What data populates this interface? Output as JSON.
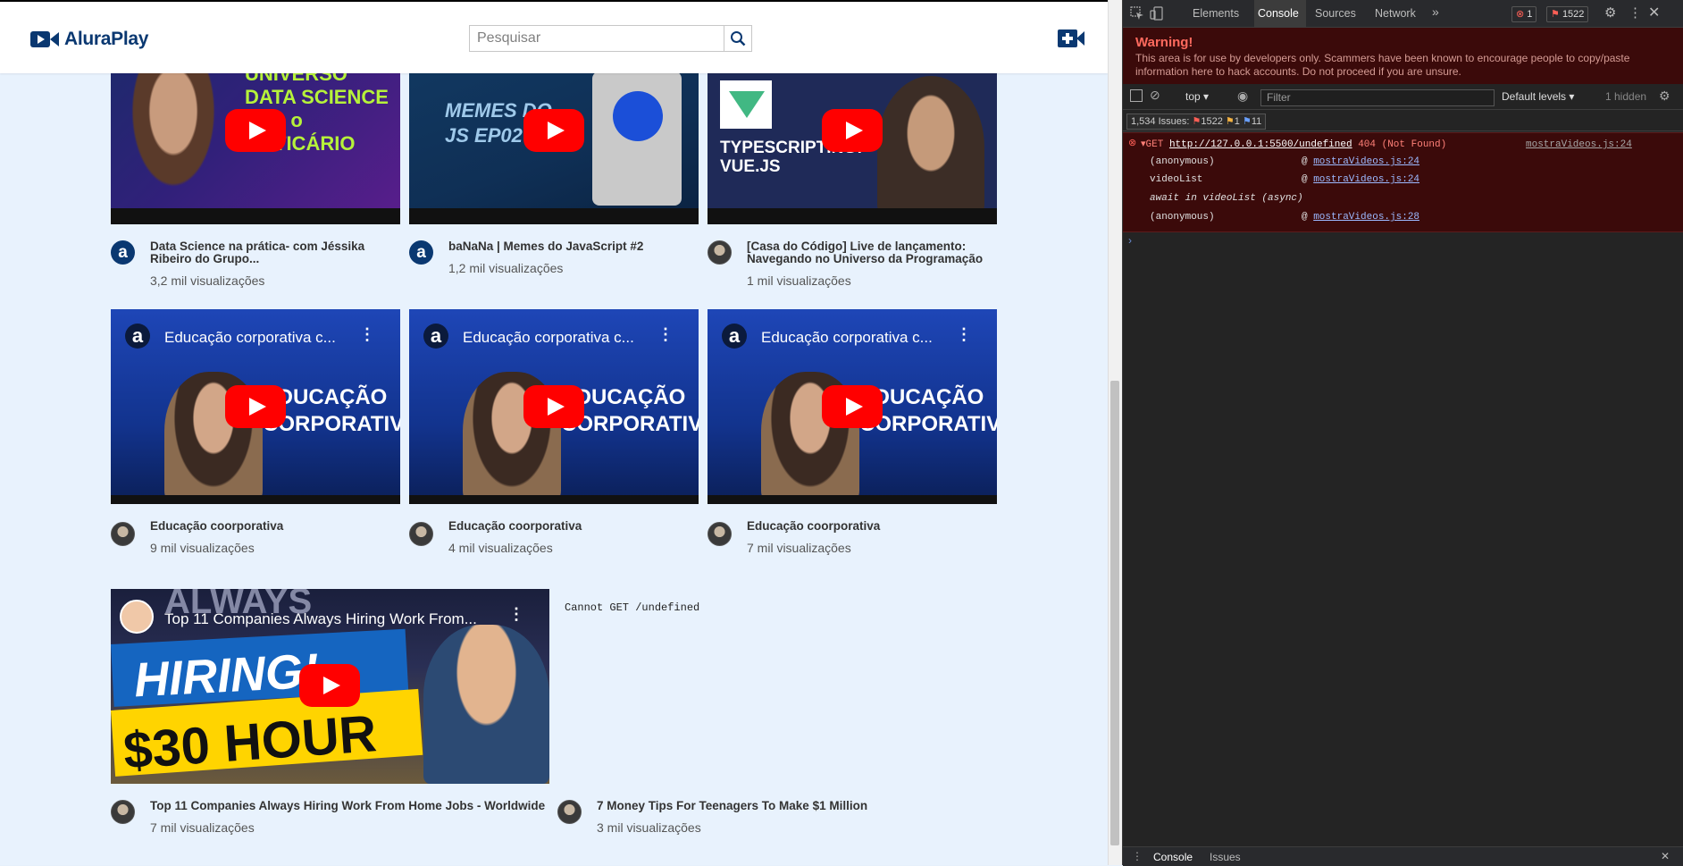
{
  "app": {
    "logo_text": "AluraPlay",
    "search_placeholder": "Pesquisar"
  },
  "videos_row1": [
    {
      "title": "Data Science na prática- com Jéssika Ribeiro do Grupo...",
      "views": "3,2 mil visualizações",
      "thumb_text": "UNIVERSO DATA SCIENCE com o BOTICÁRIO"
    },
    {
      "title": "baNaNa | Memes do JavaScript #2",
      "views": "1,2 mil visualizações",
      "thumb_text": "MEMES DO JS EP02"
    },
    {
      "title": "[Casa do Código] Live de lançamento: Navegando no Universo da Programação",
      "views": "1 mil visualizações",
      "thumb_text": "TYPESCRIPTING: VUE.JS"
    }
  ],
  "videos_row2": [
    {
      "title": "Educação coorporativa",
      "views": "9 mil visualizações",
      "thumb_title": "Educação corporativa c...",
      "thumb_text": "EDUCAÇÃO CORPORATIVA"
    },
    {
      "title": "Educação coorporativa",
      "views": "4 mil visualizações",
      "thumb_title": "Educação corporativa c...",
      "thumb_text": "EDUCAÇÃO CORPORATIVA"
    },
    {
      "title": "Educação coorporativa",
      "views": "7 mil visualizações",
      "thumb_title": "Educação corporativa c...",
      "thumb_text": "EDUCAÇÃO CORPORATIVA"
    }
  ],
  "videos_row3": [
    {
      "title": "Top 11 Companies Always Hiring Work From Home Jobs - Worldwide",
      "views": "7 mil visualizações",
      "thumb_title": "Top 11 Companies Always Hiring Work From...",
      "thumb_text1": "ALWAYS",
      "thumb_text2": "HIRING!",
      "thumb_text3": "$30 HOUR"
    },
    {
      "title": "7 Money Tips For Teenagers To Make $1 Million",
      "views": "3 mil visualizações",
      "frame_error": "Cannot GET /undefined"
    }
  ],
  "devtools": {
    "tabs": [
      "Elements",
      "Console",
      "Sources",
      "Network"
    ],
    "active_tab": "Console",
    "error_count": "1",
    "issue_count": "1522",
    "warning_title": "Warning!",
    "warning_text": "This area is for use by developers only. Scammers have been known to encourage people to copy/paste information here to hack accounts. Do not proceed if you are unsure.",
    "context": "top",
    "filter_placeholder": "Filter",
    "levels": "Default levels",
    "hidden": "1 hidden",
    "issues_summary": "1,534 Issues:",
    "issues_errors": "1522",
    "issues_warnings": "1",
    "issues_info": "11",
    "error": {
      "method": "GET",
      "url": "http://127.0.0.1:5500/undefined",
      "status": "404 (Not Found)",
      "source": "mostraVideos.js:24",
      "stack": [
        {
          "fn": "(anonymous)",
          "loc": "mostraVideos.js:24"
        },
        {
          "fn": "videoList",
          "loc": "mostraVideos.js:24"
        },
        {
          "fn": "await in videoList (async)",
          "loc": ""
        },
        {
          "fn": "(anonymous)",
          "loc": "mostraVideos.js:28"
        }
      ]
    },
    "drawer_tabs": [
      "Console",
      "Issues"
    ]
  },
  "colors": {
    "brand": "#0a3871",
    "page_bg": "#e8f2fd",
    "yt_red": "#ff0000",
    "devtools_bg": "#242424",
    "error_bg": "#3b0a0a"
  }
}
